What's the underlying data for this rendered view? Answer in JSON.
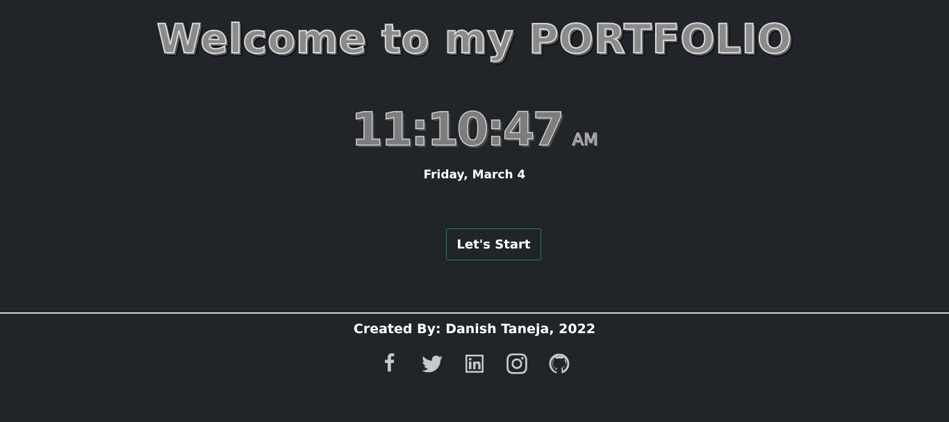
{
  "header": {
    "title": "Welcome to my PORTFOLIO"
  },
  "clock": {
    "time": "11:10:47",
    "period": "AM",
    "date": "Friday, March 4"
  },
  "actions": {
    "start_label": "Let's Start"
  },
  "footer": {
    "credit": "Created By: Danish Taneja, 2022",
    "social": [
      {
        "icon": "facebook-icon"
      },
      {
        "icon": "twitter-icon"
      },
      {
        "icon": "linkedin-icon"
      },
      {
        "icon": "instagram-icon"
      },
      {
        "icon": "github-icon"
      }
    ]
  },
  "colors": {
    "background": "#212529",
    "button_border": "#198754",
    "icon": "#c8c8c8",
    "text": "#ffffff"
  }
}
